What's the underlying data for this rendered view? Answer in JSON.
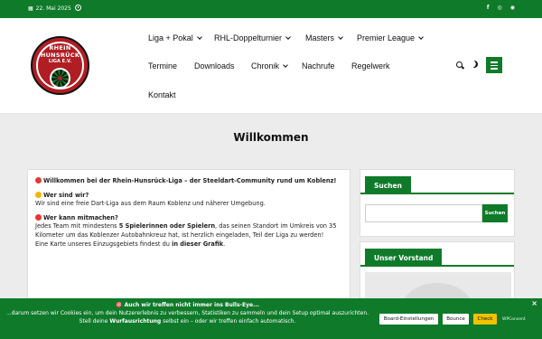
{
  "topbar": {
    "date": "22. Mai 2025",
    "calendar_icon": "calendar-icon",
    "clock_icon": "clock-icon",
    "social": [
      "f",
      "◎",
      "◉"
    ]
  },
  "logo": {
    "line1": "RHEIN",
    "line2": "HUNSRÜCK",
    "line3": "LIGA E.V."
  },
  "nav": {
    "items": [
      {
        "label": "Liga + Pokal",
        "dropdown": true
      },
      {
        "label": "RHL-Doppelturnier",
        "dropdown": true
      },
      {
        "label": "Masters",
        "dropdown": true
      },
      {
        "label": "Premier League",
        "dropdown": true
      },
      {
        "label": "Termine",
        "dropdown": false
      },
      {
        "label": "Downloads",
        "dropdown": false
      },
      {
        "label": "Chronik",
        "dropdown": true
      },
      {
        "label": "Nachrufe",
        "dropdown": false
      },
      {
        "label": "Regelwerk",
        "dropdown": false
      },
      {
        "label": "Kontakt",
        "dropdown": false
      }
    ]
  },
  "page": {
    "title": "Willkommen"
  },
  "main": {
    "intro_bold": "Willkommen bei der Rhein-Hunsrück-Liga – der Steeldart-Community rund um Koblenz!",
    "q1": "Wer sind wir?",
    "a1": "Wir sind eine freie Dart-Liga aus dem Raum Koblenz und näherer Umgebung.",
    "q2": "Wer kann mitmachen?",
    "a2_pre": "Jedes Team mit mindestens ",
    "a2_bold": "5 Spielerinnen oder Spielern",
    "a2_post": ", das seinen Standort im Umkreis von 35 Kilometer um das Koblenzer Autobahnkreuz hat, ist herzlich eingeladen, Teil der Liga zu werden!",
    "a2_map_pre": "Eine Karte unseres Einzugsgebiets findest du ",
    "a2_map_link": "in dieser Grafik",
    "a2_map_post": "."
  },
  "sidebar": {
    "search_title": "Suchen",
    "search_button": "Suchen",
    "search_placeholder": "",
    "vorstand_title": "Unser Vorstand"
  },
  "cookie": {
    "line1": "🎯 Auch wir treffen nicht immer ins Bulls-Eye...",
    "line2": "...darum setzen wir Cookies ein, um dein Nutzererlebnis zu verbessern, Statistiken zu sammeln und dein Setup optimal auszurichten.",
    "line3_pre": "Stell deine ",
    "line3_bold": "Wurfausrichtung",
    "line3_post": " selbst ein – oder wir treffen einfach automatisch.",
    "btn_settings": "Board-Einstellungen",
    "btn_bounce": "Bounce",
    "btn_check": "Check",
    "brand": "WPConsent",
    "close": "×"
  }
}
